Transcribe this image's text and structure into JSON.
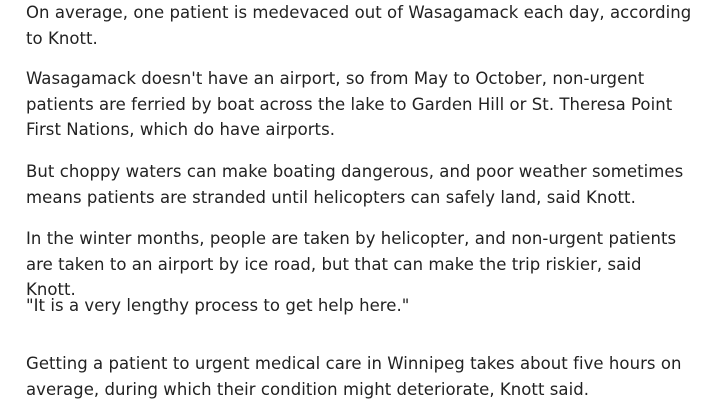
{
  "article": {
    "paragraphs": [
      "On average, one patient is medevaced out of Wasagamack each day, according to Knott.",
      "Wasagamack doesn't have an airport, so from May to October, non-urgent patients are ferried by boat across the lake to Garden Hill or St. Theresa Point First Nations, which do have airports.",
      "But choppy waters can make boating dangerous, and poor weather sometimes means patients are stranded until helicopters can safely land, said Knott.",
      "In the winter months, people are taken by helicopter, and non-urgent patients are taken to an airport by ice road, but that can make the trip riskier, said Knott.",
      "\"It is a very lengthy process to get help here.\"",
      "Getting a patient to urgent medical care in Winnipeg takes about five hours on average, during which their condition might deteriorate, Knott said."
    ]
  }
}
